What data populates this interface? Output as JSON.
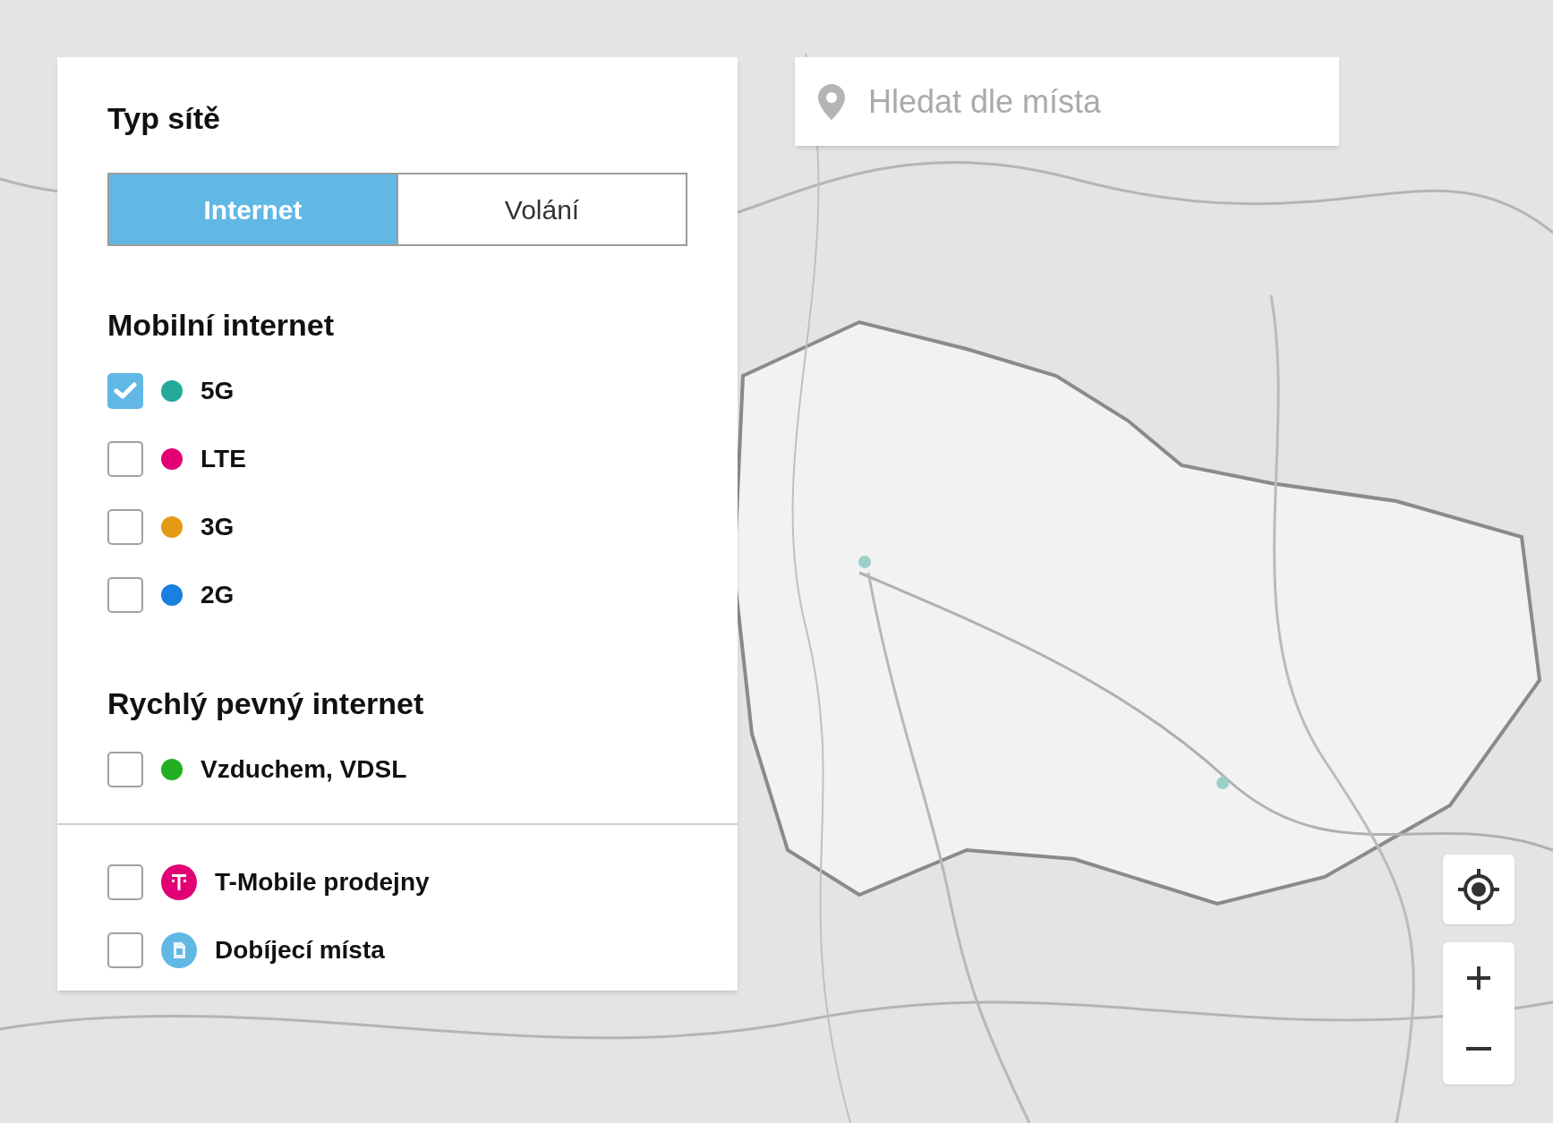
{
  "filter_panel": {
    "title": "Typ sítě",
    "tabs": [
      {
        "label": "Internet",
        "selected": true
      },
      {
        "label": "Volání",
        "selected": false
      }
    ],
    "sections": [
      {
        "heading": "Mobilní internet",
        "options": [
          {
            "label": "5G",
            "checked": true,
            "color": "#22a99a"
          },
          {
            "label": "LTE",
            "checked": false,
            "color": "#e20074"
          },
          {
            "label": "3G",
            "checked": false,
            "color": "#e49a14"
          },
          {
            "label": "2G",
            "checked": false,
            "color": "#1a7fe0"
          }
        ]
      },
      {
        "heading": "Rychlý pevný internet",
        "options": [
          {
            "label": "Vzduchem, VDSL",
            "checked": false,
            "color": "#22b022"
          }
        ]
      }
    ],
    "places": [
      {
        "label": "T-Mobile prodejny",
        "checked": false,
        "kind": "store"
      },
      {
        "label": "Dobíjecí místa",
        "checked": false,
        "kind": "topup"
      }
    ]
  },
  "search": {
    "placeholder": "Hledat dle místa"
  }
}
